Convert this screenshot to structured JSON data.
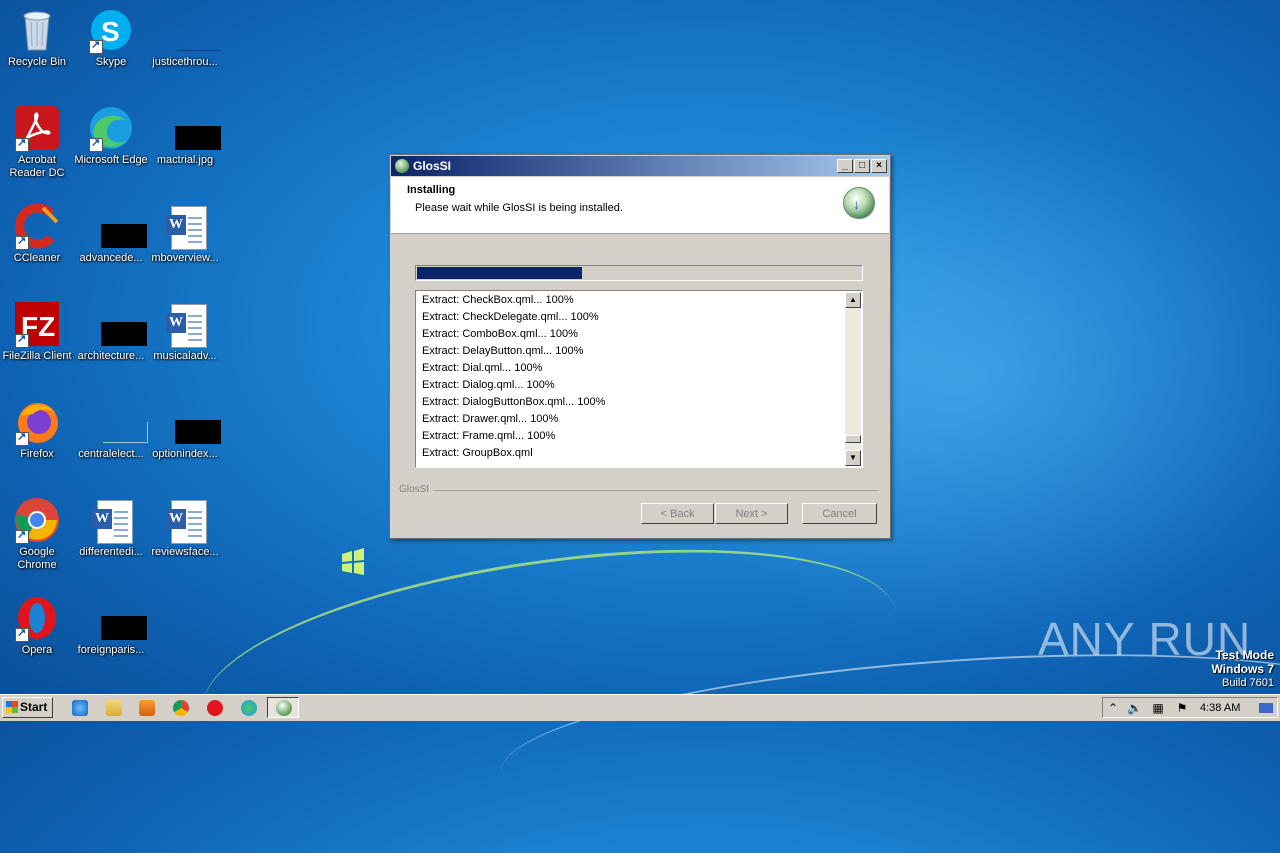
{
  "desktop": {
    "icons": [
      {
        "label": "Recycle Bin"
      },
      {
        "label": "Skype"
      },
      {
        "label": "justicethrou..."
      },
      {
        "label": "Acrobat Reader DC"
      },
      {
        "label": "Microsoft Edge"
      },
      {
        "label": "mactrial.jpg"
      },
      {
        "label": "CCleaner"
      },
      {
        "label": "advancede..."
      },
      {
        "label": "mboverview..."
      },
      {
        "label": "FileZilla Client"
      },
      {
        "label": "architecture..."
      },
      {
        "label": "musicaladv..."
      },
      {
        "label": "Firefox"
      },
      {
        "label": "centralelect..."
      },
      {
        "label": "optionindex..."
      },
      {
        "label": "Google Chrome"
      },
      {
        "label": "differentedi..."
      },
      {
        "label": "reviewsface..."
      },
      {
        "label": "Opera"
      },
      {
        "label": "foreignparis..."
      }
    ]
  },
  "window": {
    "title": "GlosSI",
    "header_title": "Installing",
    "header_subtitle": "Please wait while GlosSI is being installed.",
    "progress": 0.37,
    "log_lines": [
      "Extract: CheckBox.qml... 100%",
      "Extract: CheckDelegate.qml... 100%",
      "Extract: ComboBox.qml... 100%",
      "Extract: DelayButton.qml... 100%",
      "Extract: Dial.qml... 100%",
      "Extract: Dialog.qml... 100%",
      "Extract: DialogButtonBox.qml... 100%",
      "Extract: Drawer.qml... 100%",
      "Extract: Frame.qml... 100%",
      "Extract: GroupBox.qml"
    ],
    "brand_label": "GlosSI",
    "buttons": {
      "back": "< Back",
      "next": "Next >",
      "cancel": "Cancel"
    }
  },
  "taskbar": {
    "start_label": "Start",
    "clock": "4:38 AM"
  },
  "watermark": {
    "anyrun": "ANY RUN",
    "test_mode": "Test Mode",
    "os": "Windows 7",
    "build": "Build 7601"
  },
  "colors": {
    "title_gradient_start": "#0b246a",
    "progress_fill": "#0a246a",
    "desktop_blue": "#1b83d2"
  }
}
